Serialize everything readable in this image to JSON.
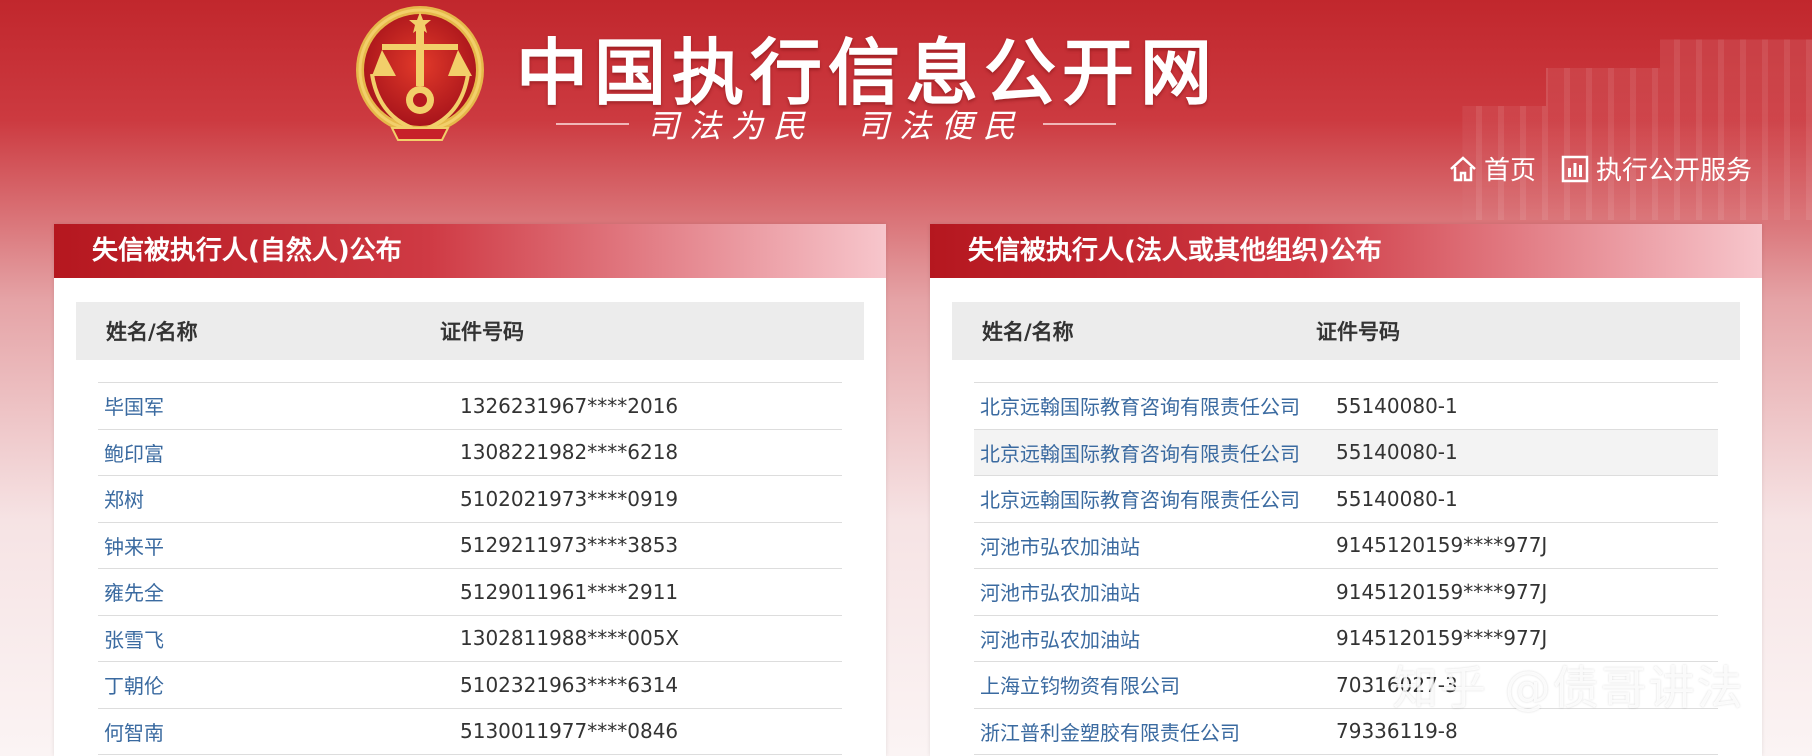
{
  "header": {
    "site_title": "中国执行信息公开网",
    "slogan": "司法为民　司法便民",
    "nav": [
      {
        "label": "首页",
        "icon": "home-icon"
      },
      {
        "label": "执行公开服务",
        "icon": "bar-chart-icon"
      }
    ]
  },
  "left_panel": {
    "title": "失信被执行人(自然人)公布",
    "col_name": "姓名/名称",
    "col_id": "证件号码",
    "rows": [
      {
        "name": "毕国军",
        "id": "1326231967****2016"
      },
      {
        "name": "鲍印富",
        "id": "1308221982****6218"
      },
      {
        "name": "郑树",
        "id": "5102021973****0919"
      },
      {
        "name": "钟来平",
        "id": "5129211973****3853"
      },
      {
        "name": "雍先全",
        "id": "5129011961****2911"
      },
      {
        "name": "张雪飞",
        "id": "1302811988****005X"
      },
      {
        "name": "丁朝伦",
        "id": "5102321963****6314"
      },
      {
        "name": "何智南",
        "id": "5130011977****0846"
      }
    ]
  },
  "right_panel": {
    "title": "失信被执行人(法人或其他组织)公布",
    "col_name": "姓名/名称",
    "col_id": "证件号码",
    "rows": [
      {
        "name": "北京远翰国际教育咨询有限责任公司",
        "id": "55140080-1"
      },
      {
        "name": "北京远翰国际教育咨询有限责任公司",
        "id": "55140080-1"
      },
      {
        "name": "北京远翰国际教育咨询有限责任公司",
        "id": "55140080-1"
      },
      {
        "name": "河池市弘农加油站",
        "id": "9145120159****977J"
      },
      {
        "name": "河池市弘农加油站",
        "id": "9145120159****977J"
      },
      {
        "name": "河池市弘农加油站",
        "id": "9145120159****977J"
      },
      {
        "name": "上海立钧物资有限公司",
        "id": "70316027-3"
      },
      {
        "name": "浙江普利金塑胶有限责任公司",
        "id": "79336119-8"
      }
    ]
  },
  "watermark": "知乎 @债哥讲法",
  "colors": {
    "brand_red": "#c1272d",
    "link_blue": "#3a6aa0"
  }
}
